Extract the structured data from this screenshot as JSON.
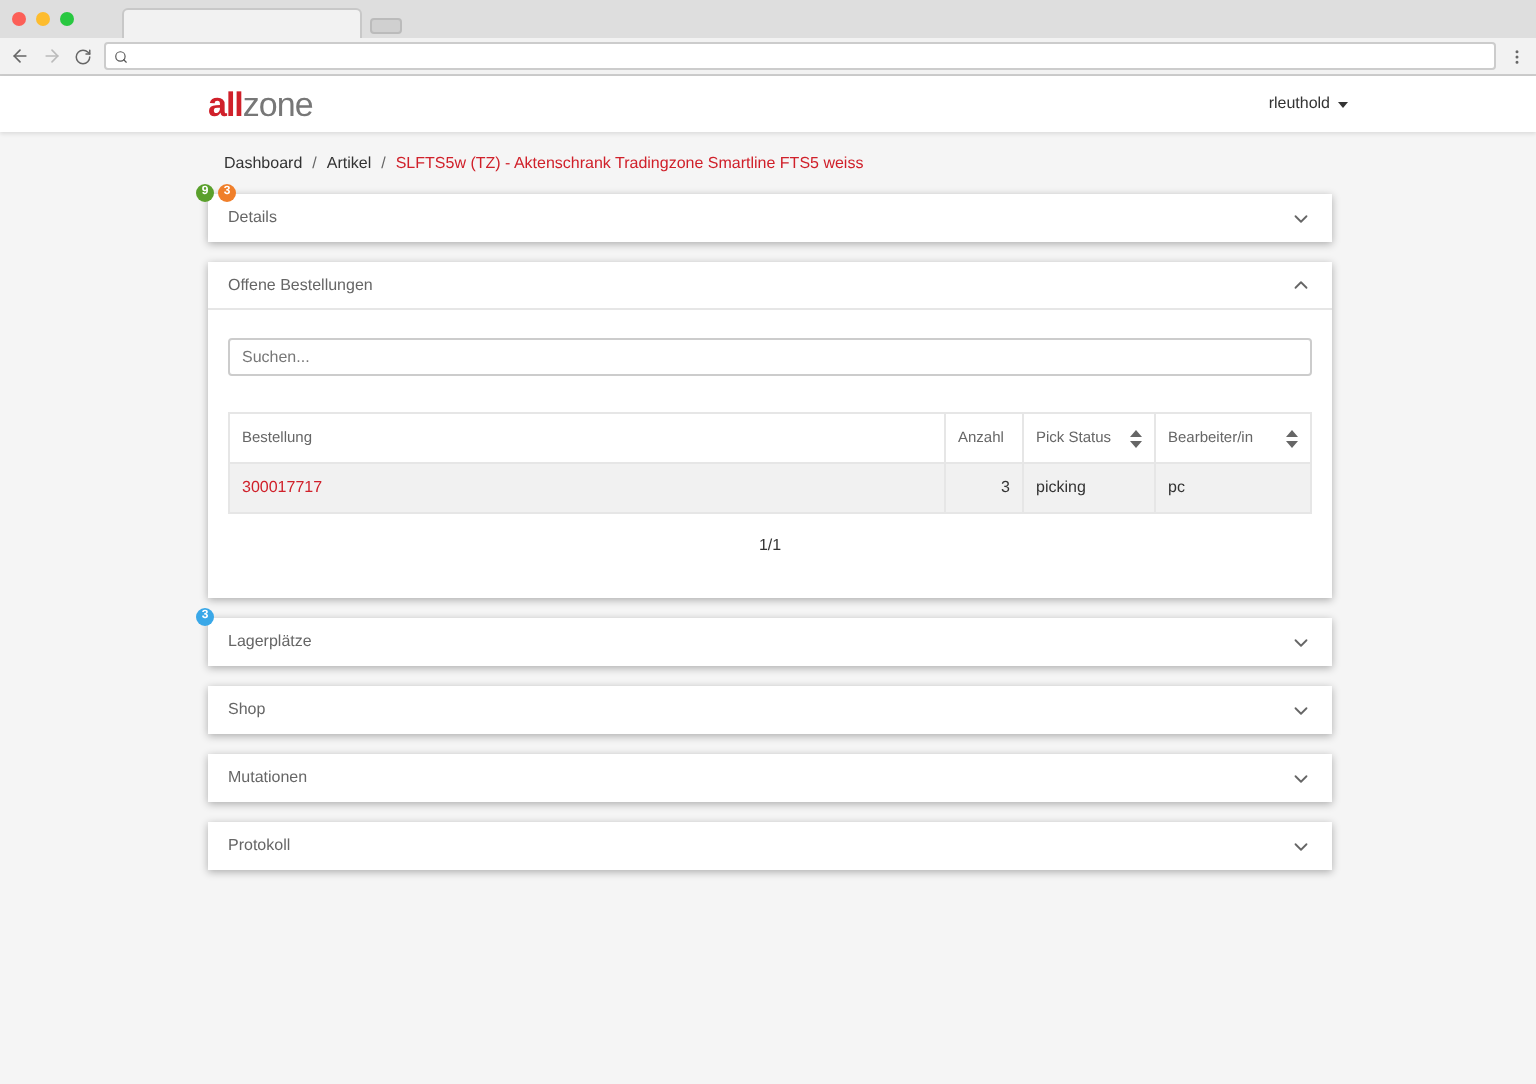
{
  "header": {
    "logo_parts": [
      {
        "text": "all",
        "color": "#d0202a"
      },
      {
        "text": "zone",
        "color": "#777777"
      }
    ],
    "user": "rleuthold"
  },
  "breadcrumb": [
    {
      "label": "Dashboard",
      "current": false
    },
    {
      "label": "Artikel",
      "current": false,
      "separator": "/"
    },
    {
      "separator": "/",
      "label": "SLFTS5w (TZ) - Aktenschrank Tradingzone Smartline FTS5 weiss",
      "current": true
    }
  ],
  "panels": [
    {
      "title": "Details",
      "expanded": false,
      "badges": [
        {
          "text": "9",
          "color": "#5aa02c"
        },
        {
          "text": "3",
          "color": "#f07f2a"
        }
      ]
    },
    {
      "title": "Offene Bestellungen",
      "expanded": true,
      "search": {
        "placeholder": "Suchen..."
      },
      "table": {
        "columns": [
          {
            "label": "Bestellung",
            "sortable": false
          },
          {
            "label": "Anzahl",
            "sortable": false
          },
          {
            "label": "Pick Status",
            "sortable": true
          },
          {
            "label": "Bearbeiter/in",
            "sortable": true
          }
        ],
        "rows": [
          [
            "300017717",
            "3",
            "picking",
            "pc"
          ]
        ]
      },
      "pagination": "1/1"
    },
    {
      "title": "Lagerplätze",
      "expanded": false,
      "badges": [
        {
          "text": "3",
          "color": "#3aa8e8"
        }
      ]
    },
    {
      "title": "Shop",
      "expanded": false
    },
    {
      "title": "Mutationen",
      "expanded": false
    },
    {
      "title": "Protokoll",
      "expanded": false
    }
  ]
}
